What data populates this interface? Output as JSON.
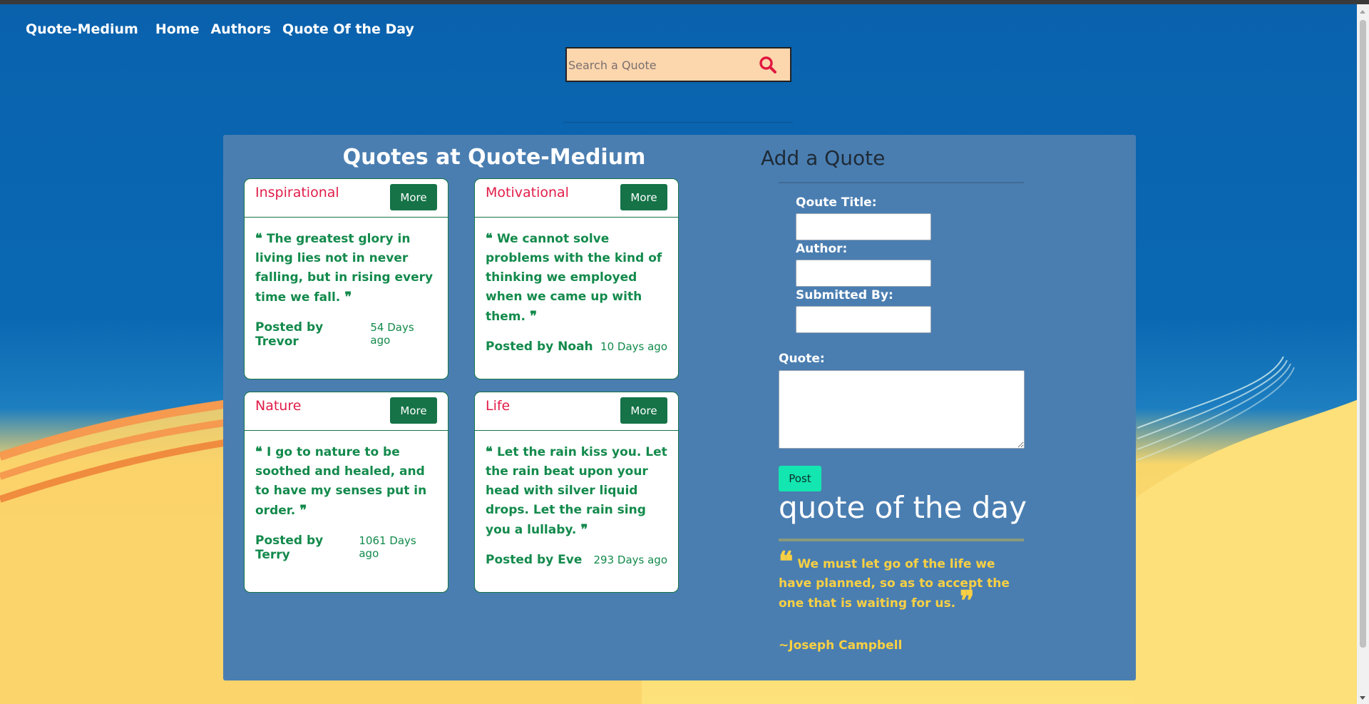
{
  "nav": {
    "brand": "Quote-Medium",
    "links": [
      "Home",
      "Authors",
      "Quote Of the Day"
    ]
  },
  "search": {
    "placeholder": "Search a Quote",
    "icon": "search-icon"
  },
  "quotes": {
    "title": "Quotes at Quote-Medium",
    "more_label": "More",
    "cards": [
      {
        "category": "Inspirational",
        "text": "The greatest glory in living lies not in never falling, but in rising every time we fall.",
        "posted_by": "Posted by Trevor",
        "ago": "54 Days ago"
      },
      {
        "category": "Motivational",
        "text": "We cannot solve problems with the kind of thinking we employed when we came up with them.",
        "posted_by": "Posted by Noah",
        "ago": "10 Days ago"
      },
      {
        "category": "Nature",
        "text": "I go to nature to be soothed and healed, and to have my senses put in order.",
        "posted_by": "Posted by Terry",
        "ago": "1061 Days ago"
      },
      {
        "category": "Life",
        "text": "Let the rain kiss you. Let the rain beat upon your head with silver liquid drops. Let the rain sing you a lullaby.",
        "posted_by": "Posted by Eve",
        "ago": "293 Days ago"
      }
    ]
  },
  "form": {
    "title": "Add a Quote",
    "title_label": "Qoute Title:",
    "author_label": "Author:",
    "submitted_label": "Submitted By:",
    "quote_label": "Quote:",
    "post_label": "Post"
  },
  "qod": {
    "title": "quote of the day",
    "text": "We must let go of the life we have planned, so as to accept the one that is waiting for us.",
    "author": "~Joseph Campbell"
  },
  "colors": {
    "category": "#e11d48",
    "card_accent": "#157347",
    "qod_text": "#f9d043",
    "post_button": "#13e6b0",
    "search_bg": "#fcd6ad"
  }
}
